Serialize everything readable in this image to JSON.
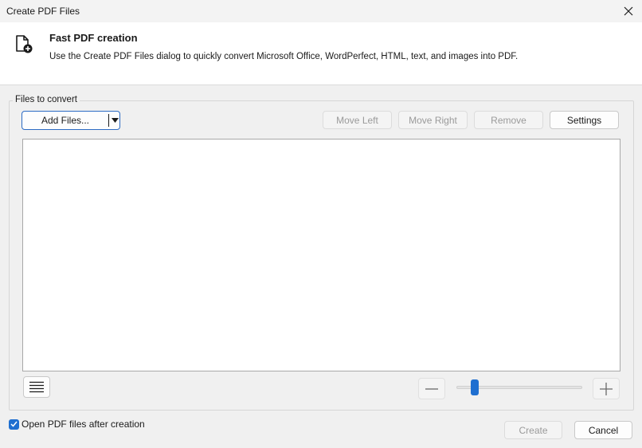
{
  "window": {
    "title": "Create PDF Files"
  },
  "header": {
    "title": "Fast PDF creation",
    "description": "Use the Create PDF Files dialog to quickly convert Microsoft Office, WordPerfect, HTML, text, and images into PDF."
  },
  "files": {
    "group_label": "Files to convert",
    "add_files_label": "Add Files...",
    "move_left_label": "Move Left",
    "move_right_label": "Move Right",
    "remove_label": "Remove",
    "settings_label": "Settings",
    "items": []
  },
  "zoom": {
    "level_fraction": 0.12
  },
  "footer": {
    "open_after_label": "Open PDF files after creation",
    "open_after_checked": true,
    "create_label": "Create",
    "cancel_label": "Cancel"
  },
  "colors": {
    "accent": "#1f6fd0",
    "disabled_text": "#9a9a9a"
  },
  "icons": [
    "close-icon",
    "document-add-icon",
    "dropdown-arrow-icon",
    "list-view-icon",
    "zoom-out-icon",
    "zoom-in-icon",
    "checkmark-icon"
  ]
}
